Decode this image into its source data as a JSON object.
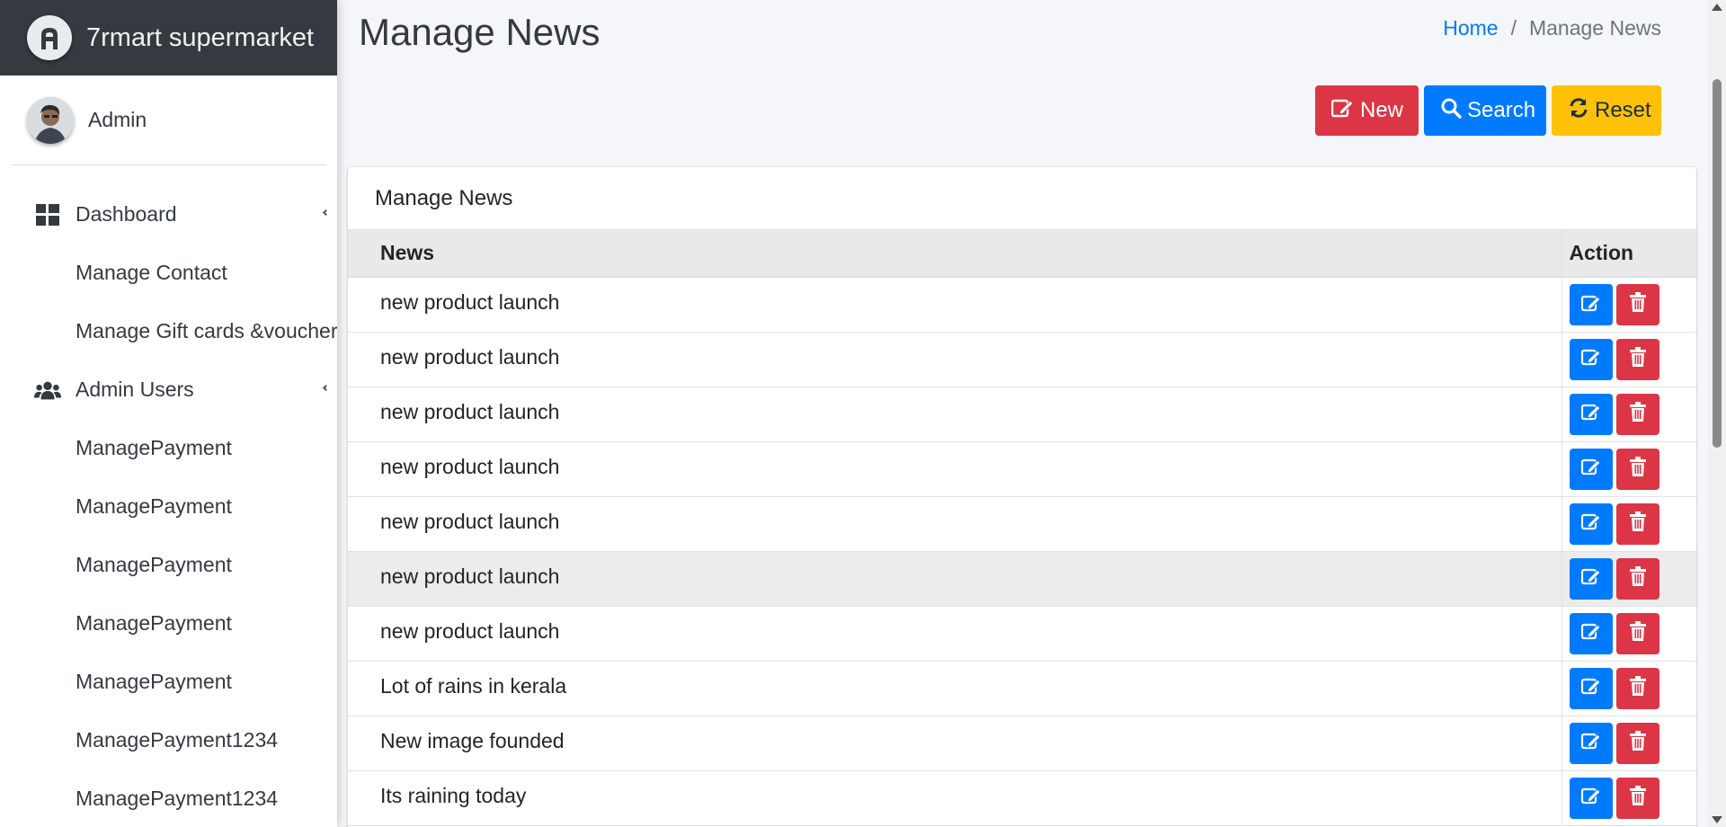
{
  "brand": {
    "name": "7rmart supermarket",
    "logo_icon": "brand-logo-icon"
  },
  "user": {
    "name": "Admin"
  },
  "sidebar": {
    "items": [
      {
        "label": "Dashboard",
        "icon": "dashboard-icon",
        "has_caret": true
      },
      {
        "label": "Manage Contact"
      },
      {
        "label": "Manage Gift cards &voucher"
      },
      {
        "label": "Admin Users",
        "icon": "users-icon",
        "has_caret": true
      },
      {
        "label": "ManagePayment"
      },
      {
        "label": "ManagePayment"
      },
      {
        "label": "ManagePayment"
      },
      {
        "label": "ManagePayment"
      },
      {
        "label": "ManagePayment"
      },
      {
        "label": "ManagePayment1234"
      },
      {
        "label": "ManagePayment1234"
      }
    ]
  },
  "header": {
    "title": "Manage News"
  },
  "breadcrumb": {
    "home": "Home",
    "separator": "/",
    "current": "Manage News"
  },
  "toolbar": {
    "new_label": "New",
    "search_label": "Search",
    "reset_label": "Reset"
  },
  "card": {
    "title": "Manage News"
  },
  "table": {
    "columns": [
      "News",
      "Action"
    ],
    "rows": [
      "new product launch",
      "new product launch",
      "new product launch",
      "new product launch",
      "new product launch",
      "new product launch",
      "new product launch",
      "Lot of rains in kerala",
      "New image founded",
      "Its raining today"
    ]
  },
  "colors": {
    "primary": "#007bff",
    "danger": "#dc3545",
    "warning": "#ffc107",
    "brand_bg": "#343a40"
  }
}
